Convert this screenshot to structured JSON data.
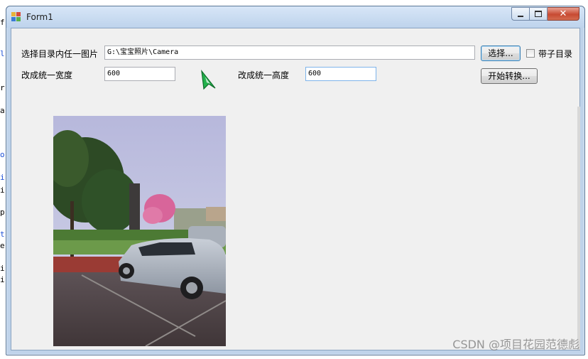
{
  "window": {
    "title": "Form1"
  },
  "background_editor": {
    "fragments": [
      "f",
      "l",
      "r",
      "a",
      "o",
      "i",
      "i",
      "p",
      "t",
      "e",
      "i",
      "i"
    ]
  },
  "form": {
    "folder_label": "选择目录内任一图片",
    "folder_path": "G:\\宝宝照片\\Camera",
    "browse_button": "选择...",
    "subfolder_checkbox": {
      "label": "带子目录",
      "checked": false
    },
    "width_label": "改成统一宽度",
    "width_value": "600",
    "height_label": "改成统一高度",
    "height_value": "600",
    "start_button": "开始转换..."
  },
  "watermark": "CSDN @项目花园范德彪",
  "colors": {
    "accent": "#3c7fb1",
    "close_button": "#c74a32",
    "cursor_green": "#22b14c"
  }
}
